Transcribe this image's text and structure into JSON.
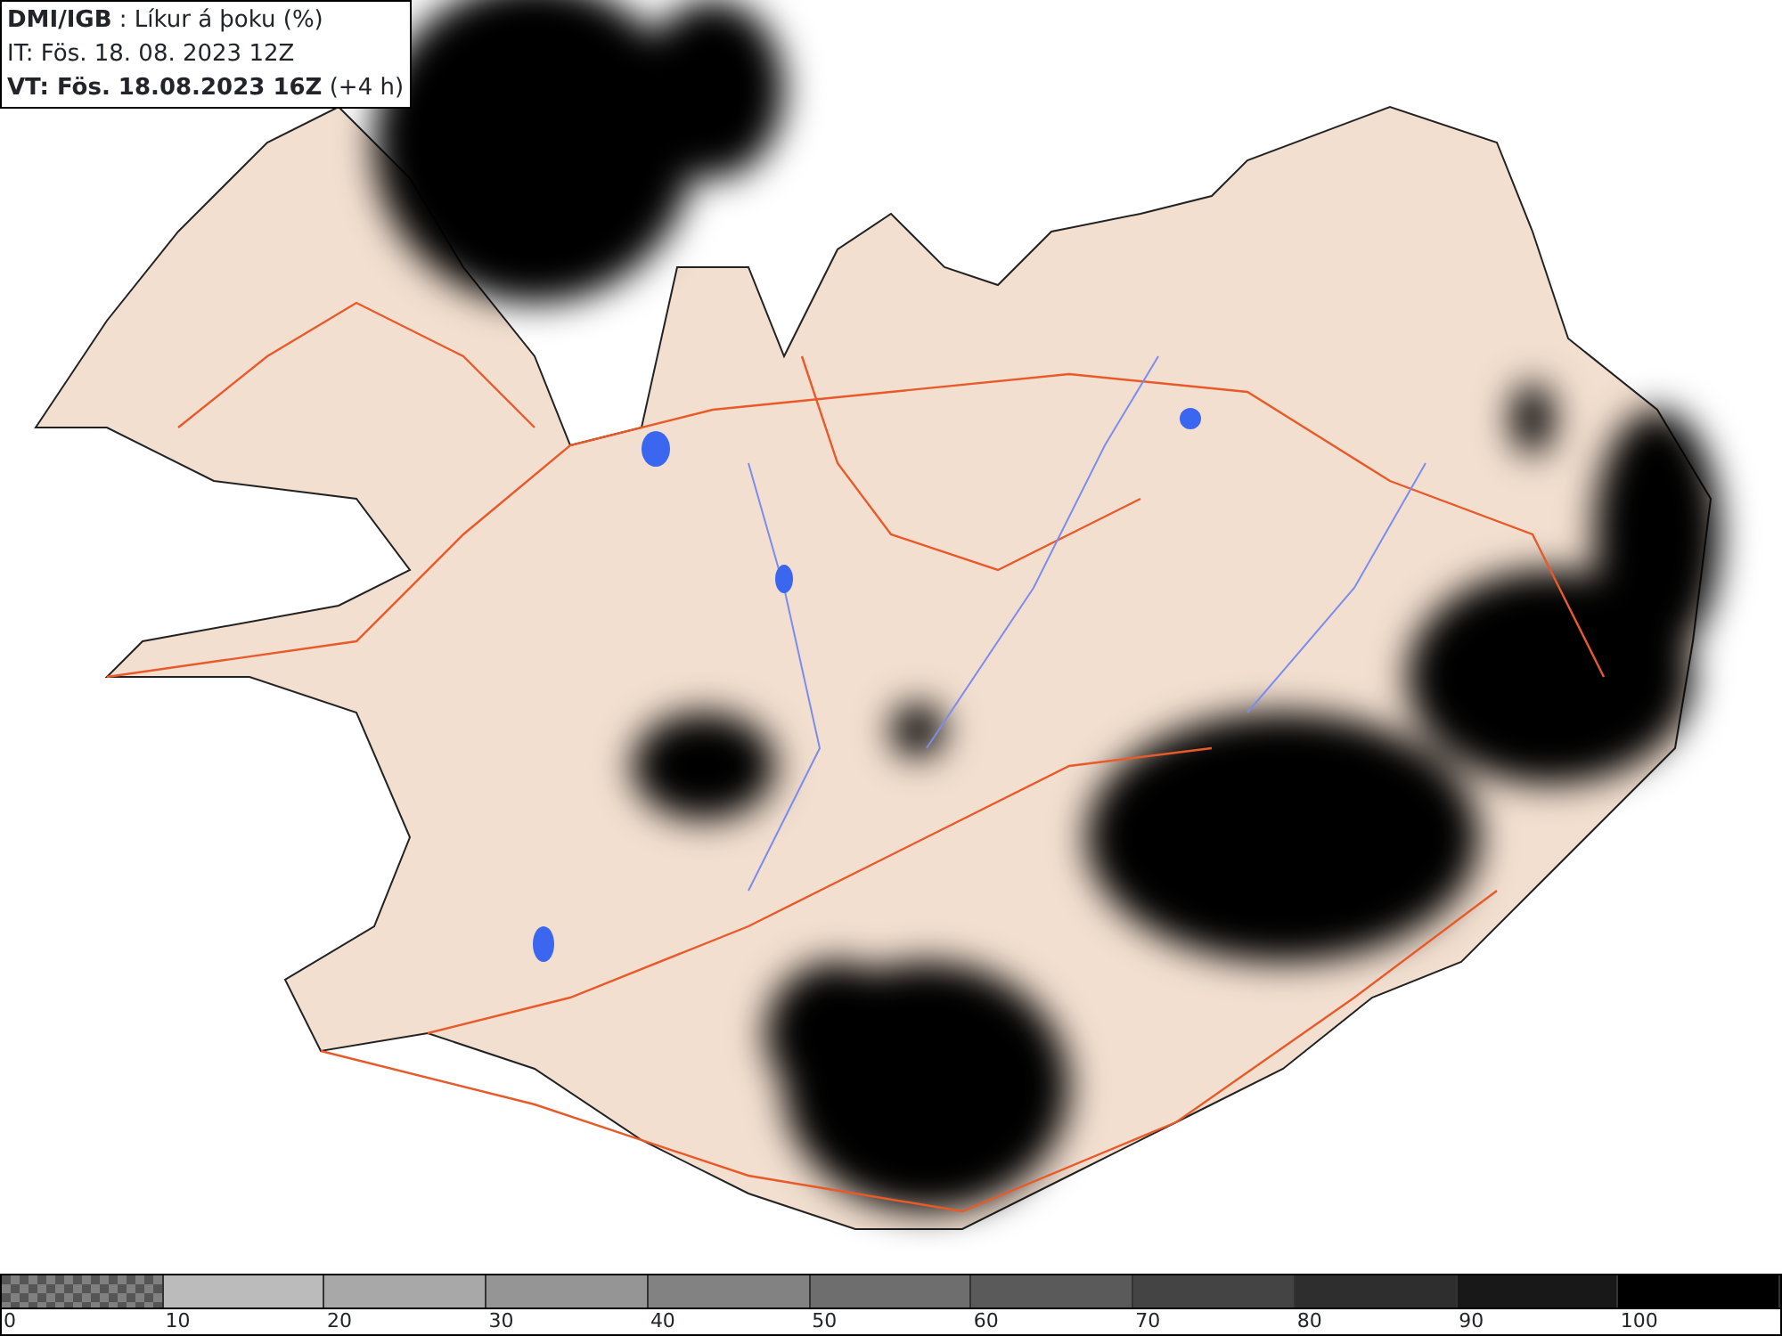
{
  "info_box": {
    "lines": [
      "**DMI/IGB** : Líkur á þoku (%)",
      "IT: Fös. 18. 08. 2023 12Z",
      "**VT: Fös. 18.08.2023 16Z** (+4 h)"
    ]
  },
  "legend": {
    "segments": [
      {
        "kind": "checkered",
        "color": "#808080",
        "label": "0"
      },
      {
        "kind": "solid",
        "color": "#bbbbbb",
        "label": "10"
      },
      {
        "kind": "solid",
        "color": "#a8a8a8",
        "label": "20"
      },
      {
        "kind": "solid",
        "color": "#959595",
        "label": "30"
      },
      {
        "kind": "solid",
        "color": "#828282",
        "label": "40"
      },
      {
        "kind": "solid",
        "color": "#6e6e6e",
        "label": "50"
      },
      {
        "kind": "solid",
        "color": "#5a5a5a",
        "label": "60"
      },
      {
        "kind": "solid",
        "color": "#444444",
        "label": "70"
      },
      {
        "kind": "solid",
        "color": "#2e2e2e",
        "label": "80"
      },
      {
        "kind": "solid",
        "color": "#181818",
        "label": "90"
      },
      {
        "kind": "solid",
        "color": "#000000",
        "label": "100"
      }
    ]
  }
}
